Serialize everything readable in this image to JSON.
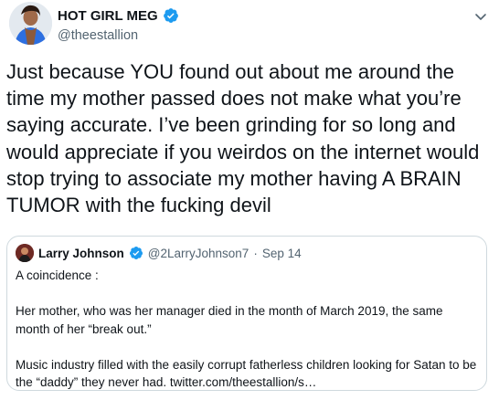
{
  "tweet": {
    "author_name": "HOT GIRL MEG",
    "author_handle": "@theestallion",
    "text": "Just because YOU found out about me around the time my mother passed does not make what you’re saying accurate. I’ve been grinding for so long and would appreciate if you weirdos on the internet would stop trying to associate my mother having A BRAIN TUMOR with the fucking devil"
  },
  "quoted_tweet": {
    "author_name": "Larry Johnson",
    "author_handle": "@2LarryJohnson7",
    "separator": "·",
    "date": "Sep 14",
    "text": "A coincidence :\n\nHer mother, who was her manager died in the month of March 2019, the same month of her “break out.”\n\nMusic industry filled with the easily corrupt fatherless children looking for Satan to be the “daddy” they never had. twitter.com/theestallion/s…"
  },
  "icons": {
    "verified": "verified-badge-icon",
    "menu": "chevron-down-icon"
  },
  "colors": {
    "verified_blue": "#1d9bf0",
    "secondary_text": "#536471",
    "border": "#cfd9de"
  }
}
